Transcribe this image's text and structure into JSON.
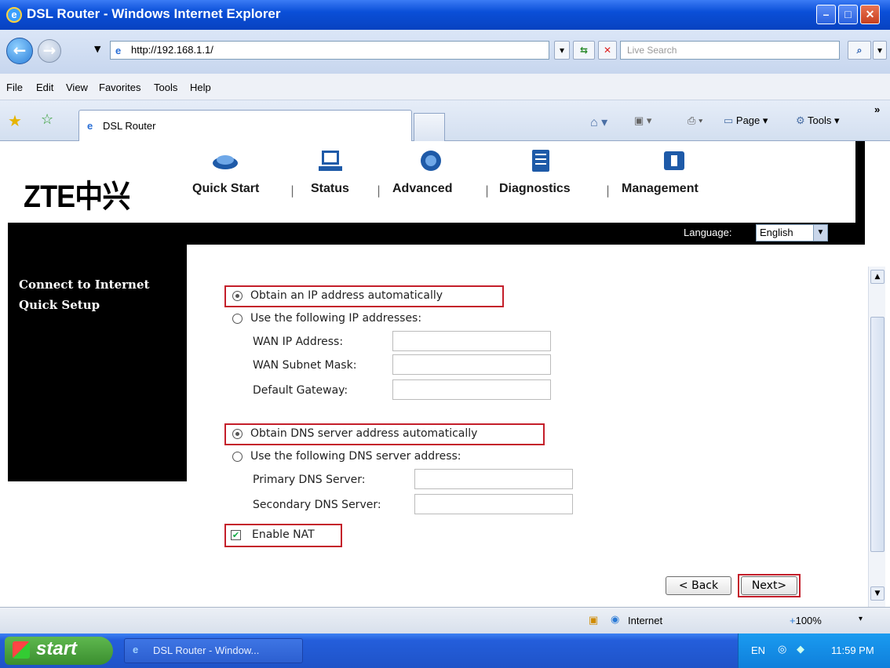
{
  "window": {
    "title": "DSL Router - Windows Internet Explorer",
    "minimize": "–",
    "maximize": "□",
    "close": "✕"
  },
  "toolbar": {
    "url": "http://192.168.1.1/",
    "search_placeholder": "Live Search",
    "back": "←",
    "forward": "→"
  },
  "menu": [
    "File",
    "Edit",
    "View",
    "Favorites",
    "Tools",
    "Help"
  ],
  "tabs": {
    "active": "DSL Router"
  },
  "commandbar": {
    "page": "Page",
    "tools": "Tools",
    "more": "»"
  },
  "router": {
    "logo": "ZTE中兴",
    "nav": [
      "Quick Start",
      "Status",
      "Advanced",
      "Diagnostics",
      "Management"
    ],
    "language_label": "Language:",
    "language_value": "English",
    "sidebar_title_1": "Connect to Internet",
    "sidebar_title_2": "Quick Setup"
  },
  "form": {
    "ip_auto": "Obtain an IP address automatically",
    "ip_manual": "Use the following IP addresses:",
    "wan_ip": "WAN IP Address:",
    "wan_mask": "WAN Subnet Mask:",
    "gateway": "Default Gateway:",
    "dns_auto": "Obtain DNS server address automatically",
    "dns_manual": "Use the following DNS server address:",
    "dns_primary": "Primary DNS Server:",
    "dns_secondary": "Secondary DNS Server:",
    "nat": "Enable NAT",
    "back_btn": "< Back",
    "next_btn": "Next>"
  },
  "statusbar": {
    "zone": "Internet",
    "zoom": "100%"
  },
  "taskbar": {
    "start": "start",
    "item": "DSL Router - Window...",
    "lang": "EN",
    "clock": "11:59 PM"
  }
}
